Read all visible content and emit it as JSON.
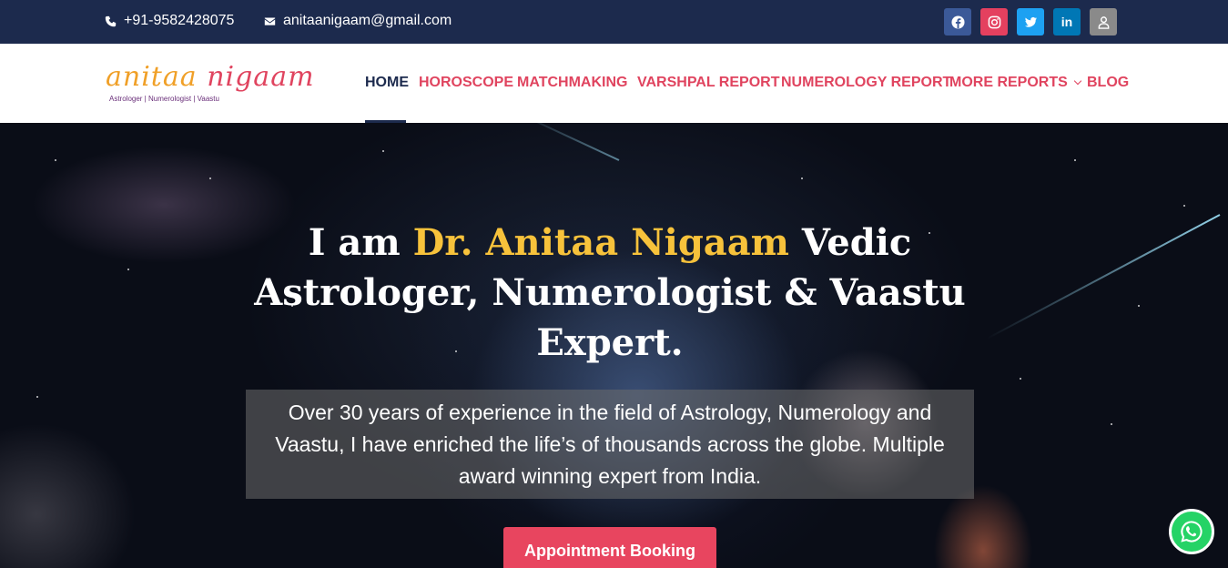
{
  "topbar": {
    "phone": "+91-9582428075",
    "email": "anitaanigaam@gmail.com",
    "social": [
      {
        "name": "facebook-icon",
        "color": "#3b5998"
      },
      {
        "name": "instagram-icon",
        "color": "#e4405f"
      },
      {
        "name": "twitter-icon",
        "color": "#1da1f2"
      },
      {
        "name": "linkedin-icon",
        "color": "#0077b5"
      },
      {
        "name": "user-icon",
        "color": "#8a8a8a"
      }
    ]
  },
  "logo": {
    "part1": "anitaa",
    "part2": "nigaam",
    "tagline": "Astrologer | Numerologist | Vaastu"
  },
  "nav": {
    "items": [
      "HOME",
      "HOROSCOPE",
      "MATCHMAKING",
      "VARSHPAL REPORT",
      "NUMEROLOGY REPORT",
      "MORE REPORTS",
      "BLOG"
    ],
    "active": "HOME"
  },
  "hero": {
    "title_pre": "I am ",
    "title_name": "Dr. Anitaa Nigaam",
    "title_post": " Vedic Astrologer, Numerologist & Vaastu Expert.",
    "description": "Over 30 years of experience in the field of Astrology, Numerology and Vaastu, I have enriched the life’s of thousands across the globe. Multiple award winning expert from India.",
    "cta_label": "Appointment Booking"
  },
  "colors": {
    "topbar_bg": "#1c2a4d",
    "accent": "#e0445f",
    "gold": "#f7c23b",
    "whatsapp": "#25d366"
  }
}
